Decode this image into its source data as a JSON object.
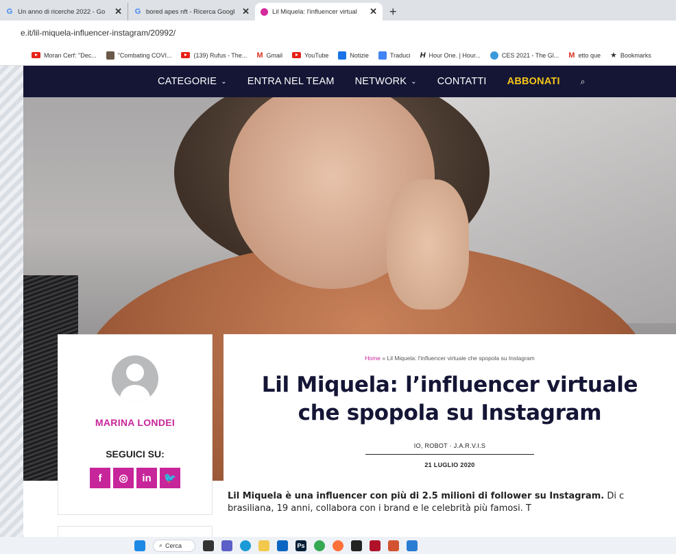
{
  "browser": {
    "tabs": [
      {
        "title": "Un anno di ricerche 2022 - Go",
        "icon": "google-icon",
        "close": "✕"
      },
      {
        "title": "bored apes nft - Ricerca Googl",
        "icon": "google-icon",
        "close": "✕"
      },
      {
        "title": "Lil Miquela: l'influencer virtual",
        "icon": "site-favicon",
        "close": "✕",
        "active": true
      }
    ],
    "new_tab": "+",
    "url": "e.it/lil-miquela-influencer-instagram/20992/",
    "bookmarks": [
      {
        "label": "Moran Cerf: \"Dec...",
        "icon": "youtube-icon"
      },
      {
        "label": "\"Combating COVI...",
        "icon": "thumbnail-icon"
      },
      {
        "label": "(139) Rufus - The...",
        "icon": "youtube-icon"
      },
      {
        "label": "Gmail",
        "icon": "gmail-icon"
      },
      {
        "label": "YouTube",
        "icon": "youtube-icon"
      },
      {
        "label": "Notizie",
        "icon": "news-icon"
      },
      {
        "label": "Traduci",
        "icon": "translate-icon"
      },
      {
        "label": "Hour One. | Hour...",
        "icon": "hourone-icon"
      },
      {
        "label": "CES 2021 - The Gl...",
        "icon": "ces-icon"
      },
      {
        "label": "etto que",
        "icon": "gmail-icon"
      },
      {
        "label": "Bookmarks",
        "icon": "star-icon"
      }
    ]
  },
  "nav": {
    "categorie": "CATEGORIE",
    "team": "ENTRA NEL TEAM",
    "network": "NETWORK",
    "contatti": "CONTATTI",
    "abbonati": "ABBONATI",
    "chevron": "⌄",
    "search_glyph": "⌕"
  },
  "author": {
    "name": "MARINA LONDEI",
    "follow_label": "SEGUICI SU:",
    "socials": [
      "f",
      "◎",
      "in",
      "🐦"
    ]
  },
  "article": {
    "breadcrumb_home": "Home",
    "breadcrumb_sep": " » ",
    "breadcrumb_current": "Lil Miquela: l'influencer virtuale che spopola su Instagram",
    "title_line1": "Lil Miquela: l’influencer virtuale",
    "title_line2": "che spopola su Instagram",
    "categories": "IO, ROBOT · J.A.R.V.I.S",
    "date": "21 LUGLIO 2020",
    "lead_bold": "Lil Miquela è una influencer con più di 2.5 milioni di follower su Instagram.",
    "lead_rest": " Di c",
    "lead_line2": "brasiliana, 19 anni, collabora con i brand e le celebrità più famosi. T"
  },
  "taskbar": {
    "search_label": "Cerca"
  },
  "colors": {
    "nav_bg": "#151636",
    "accent": "#c7259a",
    "abbonati": "#f5c518"
  }
}
